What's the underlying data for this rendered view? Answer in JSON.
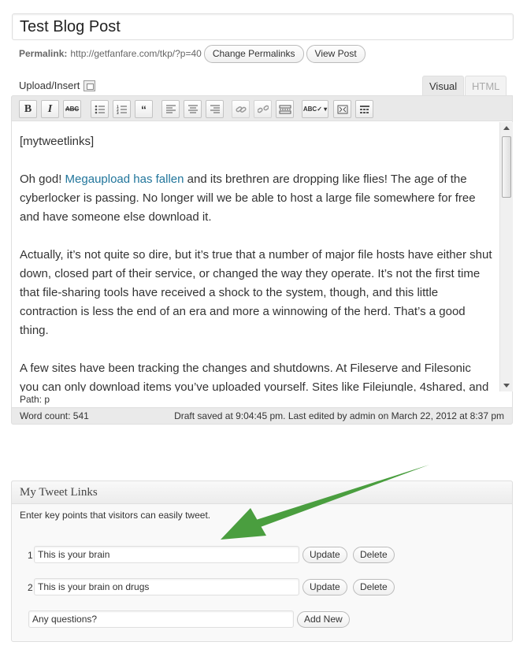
{
  "post": {
    "title": "Test Blog Post",
    "permalink_label": "Permalink:",
    "permalink_url": "http://getfanfare.com/tkp/?p=40",
    "change_permalinks": "Change Permalinks",
    "view_post": "View Post"
  },
  "editor": {
    "upload_insert": "Upload/Insert",
    "tabs": {
      "visual": "Visual",
      "html": "HTML"
    },
    "toolbar": {
      "bold": "B",
      "italic": "I",
      "strike": "ABC",
      "bullets": "bullet-list-icon",
      "numbers": "numbered-list-icon",
      "quote": "❝❞",
      "icons": [
        "align-left-icon",
        "align-center-icon",
        "align-right-icon",
        "link-icon",
        "unlink-icon",
        "more-tag-icon",
        "spellcheck-icon",
        "fullscreen-icon",
        "kitchen-sink-icon"
      ]
    },
    "content": {
      "shortcode": "[mytweetlinks]",
      "p1_before": "Oh god! ",
      "p1_link": "Megaupload has fallen",
      "p1_after": " and its brethren are dropping like flies! The age of the cyberlocker is passing. No longer will we be able to host a large file somewhere for free and have someone else download it.",
      "p2": "Actually, it’s not quite so dire, but it’s true that a number of major file hosts have either shut down, closed part of their service, or changed the way they operate. It’s not the first time that file-sharing tools have received a shock to the system, though, and this little contraction is less the end of an era and more a winnowing of the herd. That’s a good thing.",
      "p3": "A few sites have been tracking the changes and shutdowns. At Fileserve and Filesonic you can only download items you’ve uploaded yourself. Sites like Filejungle, 4shared, and"
    },
    "path": "Path: p",
    "word_count": "Word count: 541",
    "draft_status": "Draft saved at 9:04:45 pm. Last edited by admin on March 22, 2012 at 8:37 pm",
    "link_color": "#21759b"
  },
  "metabox": {
    "title": "My Tweet Links",
    "description": "Enter key points that visitors can easily tweet.",
    "items": [
      {
        "num": "1",
        "value": "This is your brain",
        "update": "Update",
        "delete": "Delete"
      },
      {
        "num": "2",
        "value": "This is your brain on drugs",
        "update": "Update",
        "delete": "Delete"
      }
    ],
    "new_placeholder": "Any questions?",
    "add_new": "Add New"
  },
  "annotation": {
    "arrow_color": "#4a9e3f"
  }
}
